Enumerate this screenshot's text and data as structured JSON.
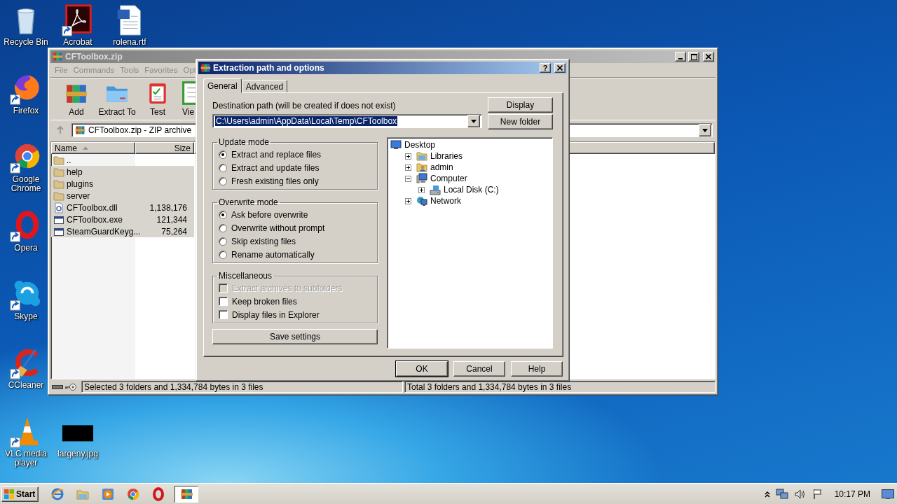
{
  "desktop": {
    "icons": [
      {
        "label": "Recycle Bin",
        "kind": "recycle",
        "shortcut": false
      },
      {
        "label": "Acrobat",
        "kind": "pdf",
        "shortcut": true
      },
      {
        "label": "rolena.rtf",
        "kind": "document",
        "shortcut": false
      },
      {
        "label": "Firefox",
        "kind": "firefox",
        "shortcut": true
      },
      {
        "label": "Google Chrome",
        "kind": "chrome",
        "shortcut": true
      },
      {
        "label": "Opera",
        "kind": "opera",
        "shortcut": true
      },
      {
        "label": "Skype",
        "kind": "skype",
        "shortcut": true
      },
      {
        "label": "CCleaner",
        "kind": "ccleaner",
        "shortcut": true
      },
      {
        "label": "VLC media player",
        "kind": "vlc",
        "shortcut": true
      },
      {
        "label": "largeny.jpg",
        "kind": "image",
        "shortcut": false
      }
    ]
  },
  "archive_window": {
    "title": "CFToolbox.zip",
    "active": false,
    "menu": [
      "File",
      "Commands",
      "Tools",
      "Favorites",
      "Opt"
    ],
    "toolbar": [
      {
        "label": "Add",
        "kind": "add"
      },
      {
        "label": "Extract To",
        "kind": "extract"
      },
      {
        "label": "Test",
        "kind": "test"
      },
      {
        "label": "Vie",
        "kind": "view"
      }
    ],
    "address": "CFToolbox.zip - ZIP archive",
    "columns": [
      {
        "label": "Name",
        "sorted": true
      },
      {
        "label": "Size",
        "sorted": false
      }
    ],
    "rows": [
      {
        "name": "..",
        "kind": "folder",
        "selected": false
      },
      {
        "name": "help",
        "kind": "folder",
        "selected": true
      },
      {
        "name": "plugins",
        "kind": "folder",
        "selected": true
      },
      {
        "name": "server",
        "kind": "folder",
        "selected": true
      },
      {
        "name": "CFToolbox.dll",
        "size": "1,138,176",
        "kind": "dll",
        "selected": true
      },
      {
        "name": "CFToolbox.exe",
        "size": "121,344",
        "kind": "exe",
        "selected": true
      },
      {
        "name": "SteamGuardKeyg...",
        "size": "75,264",
        "kind": "exe",
        "selected": true
      }
    ],
    "status_left": "Selected 3 folders and 1,334,784 bytes in 3 files",
    "status_right": "Total 3 folders and 1,334,784 bytes in 3 files"
  },
  "dialog": {
    "title": "Extraction path and options",
    "active": true,
    "help_glyph": "?",
    "tabs": [
      {
        "label": "General",
        "selected": true
      },
      {
        "label": "Advanced",
        "selected": false
      }
    ],
    "path_label": "Destination path (will be created if does not exist)",
    "path": "C:\\Users\\admin\\AppData\\Local\\Temp\\CFToolbox",
    "path_highlighted": true,
    "side_buttons": [
      "Display",
      "New folder"
    ],
    "groups": [
      {
        "title": "Update mode",
        "kind": "radio",
        "options": [
          {
            "label": "Extract and replace files",
            "selected": true
          },
          {
            "label": "Extract and update files",
            "selected": false
          },
          {
            "label": "Fresh existing files only",
            "selected": false
          }
        ]
      },
      {
        "title": "Overwrite mode",
        "kind": "radio",
        "options": [
          {
            "label": "Ask before overwrite",
            "selected": true
          },
          {
            "label": "Overwrite without prompt",
            "selected": false
          },
          {
            "label": "Skip existing files",
            "selected": false
          },
          {
            "label": "Rename automatically",
            "selected": false
          }
        ]
      },
      {
        "title": "Miscellaneous",
        "kind": "checkbox",
        "options": [
          {
            "label": "Extract archives to subfolders",
            "checked": false,
            "disabled": true
          },
          {
            "label": "Keep broken files",
            "checked": false,
            "disabled": false
          },
          {
            "label": "Display files in Explorer",
            "checked": false,
            "disabled": false
          }
        ]
      }
    ],
    "save_button": "Save settings",
    "tree": [
      {
        "label": "Desktop",
        "kind": "desktop",
        "children": [
          {
            "label": "Libraries",
            "kind": "libraries",
            "expanded": false
          },
          {
            "label": "admin",
            "kind": "user",
            "expanded": false
          },
          {
            "label": "Computer",
            "kind": "computer",
            "expanded": true,
            "children": [
              {
                "label": "Local Disk (C:)",
                "kind": "disk",
                "expanded": false
              }
            ]
          },
          {
            "label": "Network",
            "kind": "network",
            "expanded": false
          }
        ]
      }
    ],
    "buttons": [
      {
        "label": "OK",
        "default": true
      },
      {
        "label": "Cancel",
        "default": false
      },
      {
        "label": "Help",
        "default": false
      }
    ]
  },
  "taskbar": {
    "start": "Start",
    "apps": [
      {
        "kind": "ie",
        "selected": false
      },
      {
        "kind": "explorer",
        "selected": false
      },
      {
        "kind": "media",
        "selected": false
      },
      {
        "kind": "chrome",
        "selected": false
      },
      {
        "kind": "opera",
        "selected": false
      },
      {
        "kind": "winrar",
        "selected": true
      }
    ],
    "clock": "10:17 PM"
  }
}
